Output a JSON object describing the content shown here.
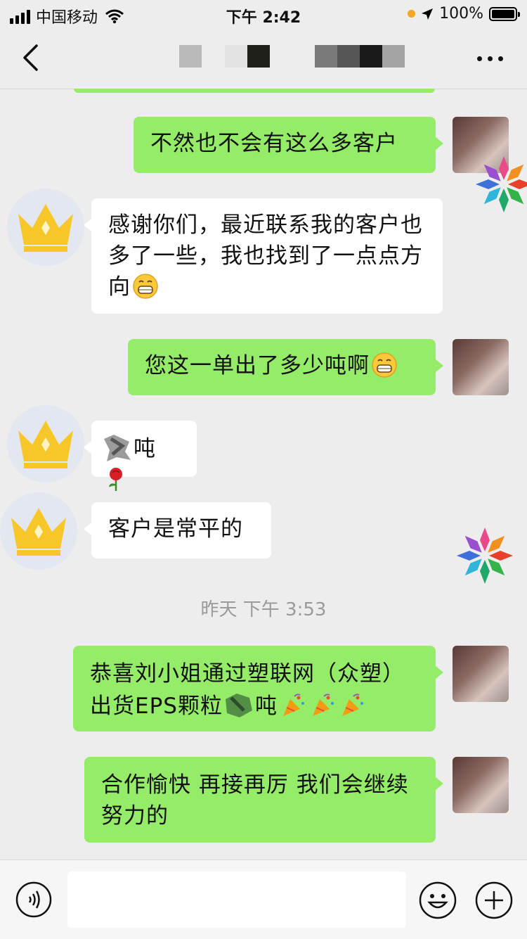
{
  "status_bar": {
    "carrier": "中国移动",
    "time": "下午 2:42",
    "battery": "100%"
  },
  "nav": {
    "title": ""
  },
  "messages": [
    {
      "side": "out",
      "text": "不然也不会有这么多客户"
    },
    {
      "side": "in",
      "text": "感谢你们，最近联系我的客户也多了一些，我也找到了一点点方向"
    },
    {
      "side": "out",
      "text": "您这一单出了多少吨啊"
    },
    {
      "side": "in",
      "text": "吨"
    },
    {
      "side": "in",
      "text": "客户是常平的"
    },
    {
      "side": "out",
      "text_a": "恭喜刘小姐通过塑联网（众塑）出货EPS颗粒",
      "text_b": "吨"
    },
    {
      "side": "out",
      "text": "合作愉快  再接再厉  我们会继续努力的"
    }
  ],
  "timestamp": "昨天 下午 3:53",
  "input": {
    "placeholder": ""
  },
  "icons": {
    "back": "chevron-left-icon",
    "more": "more-dots-icon",
    "voice": "voice-icon",
    "emoji": "emoji-icon",
    "plus": "plus-icon"
  },
  "colors": {
    "outgoing_bubble": "#95ec69",
    "incoming_bubble": "#ffffff",
    "background": "#ededed"
  }
}
